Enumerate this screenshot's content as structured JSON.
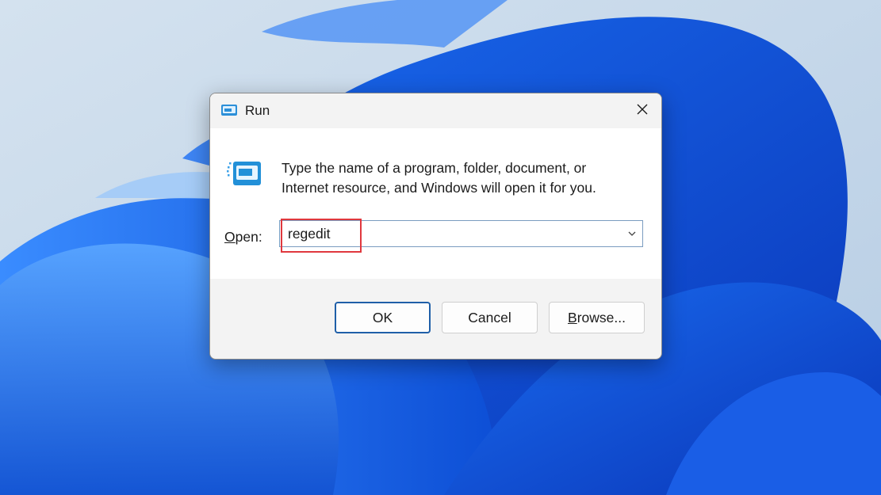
{
  "window": {
    "title": "Run",
    "icon": "run-icon"
  },
  "content": {
    "description_line1": "Type the name of a program, folder, document, or",
    "description_line2": "Internet resource, and Windows will open it for you.",
    "open_label_hotkey": "O",
    "open_label_rest": "pen:",
    "open_value": "regedit"
  },
  "buttons": {
    "ok": "OK",
    "cancel": "Cancel",
    "browse_hotkey": "B",
    "browse_rest": "rowse..."
  },
  "colors": {
    "highlight": "#e0383e",
    "accent": "#1f5fa8"
  }
}
